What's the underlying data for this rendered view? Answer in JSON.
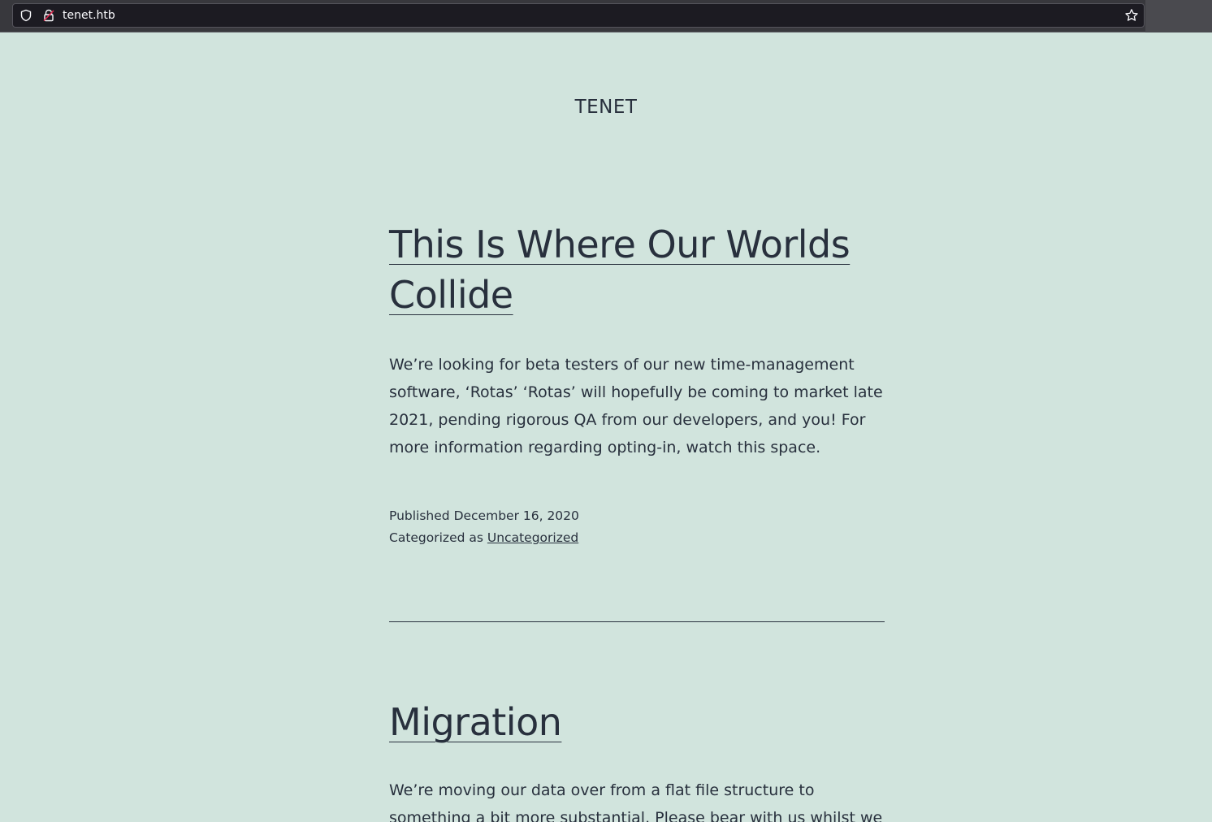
{
  "browser": {
    "url": "tenet.htb"
  },
  "site": {
    "title": "TENET"
  },
  "posts": [
    {
      "title_line1": "This Is Where Our Worlds",
      "title_line2": "Collide",
      "excerpt": "We’re looking for beta testers of our new time-management software, ‘Rotas’ ‘Rotas’ will hopefully be coming to market late 2021, pending rigorous QA from our developers, and you! For more information regarding opting-in, watch this space.",
      "published_label": "Published",
      "published_date": "December 16, 2020",
      "category_label": "Categorized as",
      "category": "Uncategorized"
    },
    {
      "title": "Migration",
      "excerpt": "We’re moving our data over from a flat file structure to something a bit more substantial. Please bear with us whilst we get one of our"
    }
  ]
}
